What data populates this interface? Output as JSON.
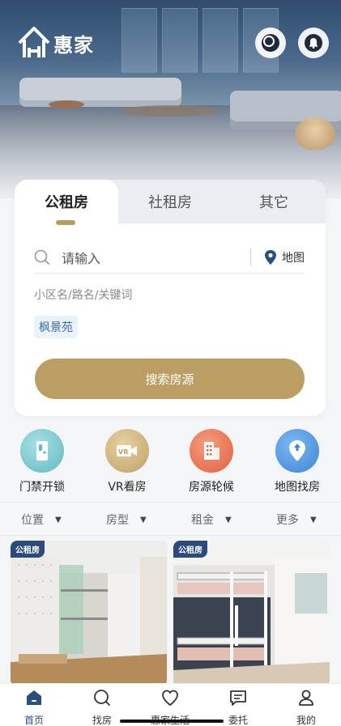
{
  "header": {
    "brand": "惠家",
    "icons": {
      "search": "search-icon",
      "notification": "bell-icon"
    }
  },
  "search_card": {
    "tabs": [
      {
        "label": "公租房",
        "active": true
      },
      {
        "label": "社租房",
        "active": false
      },
      {
        "label": "其它",
        "active": false
      }
    ],
    "search_placeholder": "请输入",
    "map_label": "地图",
    "hint": "小区名/路名/关键词",
    "history_chip": "枫景苑",
    "search_button": "搜索房源"
  },
  "quick_entries": [
    {
      "label": "门禁开锁",
      "icon": "door-lock-icon",
      "color": "#7cc8cf"
    },
    {
      "label": "VR看房",
      "icon": "vr-camera-icon",
      "color": "#d2b87d"
    },
    {
      "label": "房源轮候",
      "icon": "building-icon",
      "color": "#e97756"
    },
    {
      "label": "地图找房",
      "icon": "map-pin-icon",
      "color": "#4d96df"
    }
  ],
  "filters": [
    {
      "label": "位置"
    },
    {
      "label": "房型"
    },
    {
      "label": "租金"
    },
    {
      "label": "更多"
    }
  ],
  "listings": [
    {
      "badge": "公租房"
    },
    {
      "badge": "公租房"
    }
  ],
  "bottom_nav": [
    {
      "label": "首页",
      "icon": "home-icon",
      "active": true
    },
    {
      "label": "找房",
      "icon": "search-icon",
      "active": false
    },
    {
      "label": "惠家生活",
      "icon": "heart-icon",
      "active": false
    },
    {
      "label": "委托",
      "icon": "message-icon",
      "active": false
    },
    {
      "label": "我的",
      "icon": "person-icon",
      "active": false
    }
  ],
  "colors": {
    "brand_gold": "#bb9e62",
    "brand_navy": "#2b4f7d",
    "chip_text": "#3a6c9c"
  }
}
